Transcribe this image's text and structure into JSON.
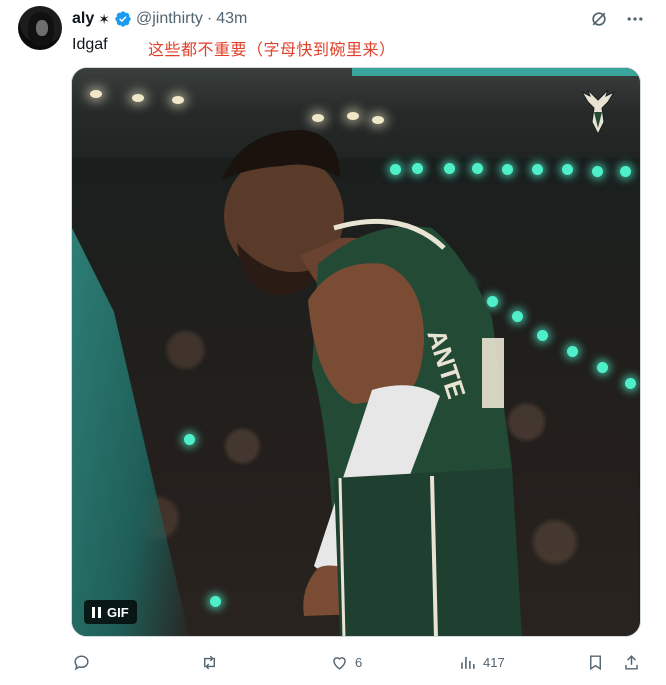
{
  "author": {
    "display_name": "aly",
    "name_suffix": "✶",
    "handle": "@jinthirty",
    "separator": "·",
    "timestamp": "43m"
  },
  "tweet": {
    "text": "Idgaf",
    "annotation": "这些都不重要（字母快到碗里来）"
  },
  "media": {
    "type_badge": "GIF",
    "jersey_text": "ANTE"
  },
  "actions": {
    "reply_count": "",
    "retweet_count": "",
    "like_count": "6",
    "view_count": "417"
  },
  "colors": {
    "accent": "#1d9bf0",
    "annotation": "#e0412b",
    "secondary_text": "#536471",
    "jersey_green": "#234a35",
    "teal": "#3aa59a"
  },
  "icons": {
    "verified": "verified-badge-icon",
    "grok": "grok-icon",
    "more": "more-icon",
    "reply": "reply-icon",
    "retweet": "retweet-icon",
    "like": "heart-icon",
    "views": "views-icon",
    "bookmark": "bookmark-icon",
    "share": "share-icon",
    "pause": "pause-icon",
    "team_logo": "deer-logo-icon"
  }
}
